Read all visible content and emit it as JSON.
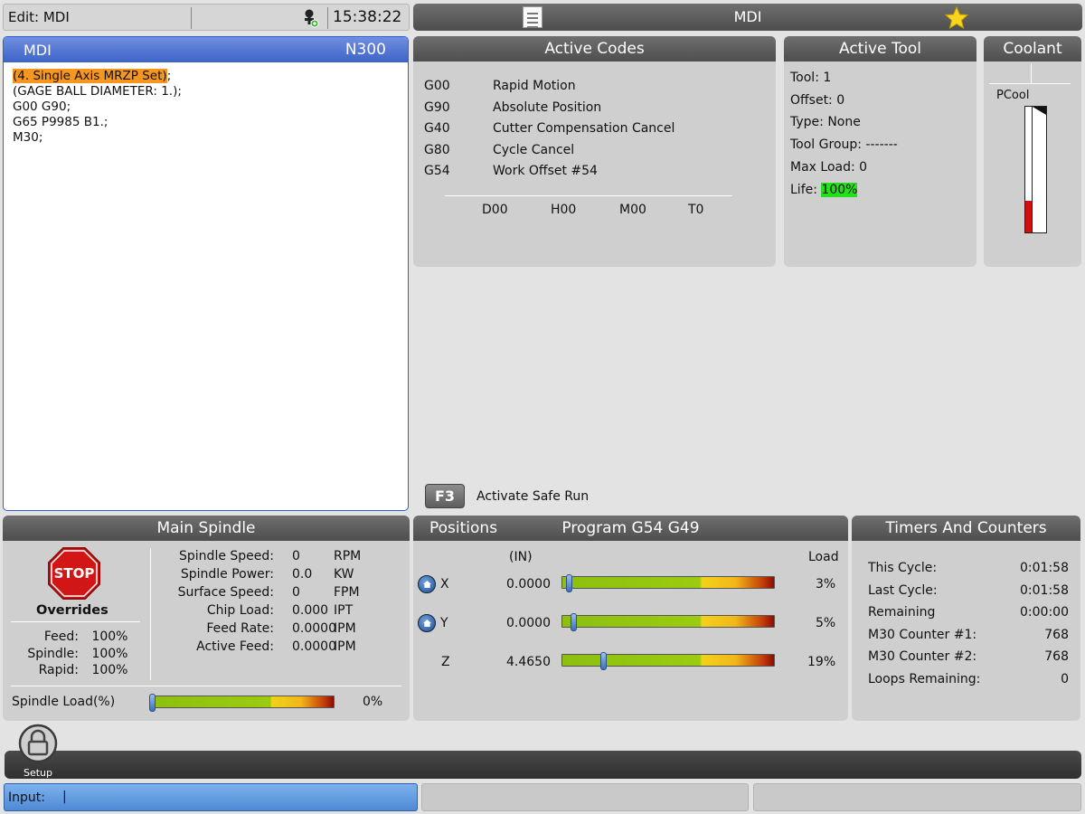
{
  "topbar": {
    "edit_label": "Edit: MDI",
    "clock": "15:38:22",
    "mode": "MDI"
  },
  "mdi": {
    "title": "MDI",
    "line": "N300",
    "lines": [
      {
        "text": "(4. Single Axis MRZP Set)",
        "suffix": ";"
      },
      {
        "text": "(GAGE BALL DIAMETER: 1.);",
        "suffix": ""
      },
      {
        "text": "G00 G90;",
        "suffix": ""
      },
      {
        "text": "G65 P9985 B1.;",
        "suffix": ""
      },
      {
        "text": "M30;",
        "suffix": ""
      }
    ]
  },
  "active_codes": {
    "title": "Active Codes",
    "rows": [
      {
        "code": "G00",
        "desc": "Rapid Motion"
      },
      {
        "code": "G90",
        "desc": "Absolute Position"
      },
      {
        "code": "G40",
        "desc": "Cutter Compensation Cancel"
      },
      {
        "code": "G80",
        "desc": "Cycle Cancel"
      },
      {
        "code": "G54",
        "desc": "Work Offset #54"
      }
    ],
    "dhmt": [
      "D00",
      "H00",
      "M00",
      "T0"
    ]
  },
  "active_tool": {
    "title": "Active Tool",
    "tool": "Tool: 1",
    "offset": "Offset: 0",
    "type": "Type: None",
    "group": "Tool Group: -------",
    "maxload": "Max Load: 0",
    "life_label": "Life:",
    "life_value": "100%"
  },
  "coolant": {
    "title": "Coolant",
    "label": "PCool",
    "level": 0.25
  },
  "safe_run": {
    "key": "F3",
    "label": "Activate Safe Run"
  },
  "spindle": {
    "title": "Main Spindle",
    "stop_label": "STOP",
    "overrides_title": "Overrides",
    "overrides": [
      {
        "label": "Feed:",
        "value": "100%"
      },
      {
        "label": "Spindle:",
        "value": "100%"
      },
      {
        "label": "Rapid:",
        "value": "100%"
      }
    ],
    "stats": [
      {
        "label": "Spindle Speed:",
        "value": "0",
        "unit": "RPM"
      },
      {
        "label": "Spindle Power:",
        "value": "0.0",
        "unit": "KW"
      },
      {
        "label": "Surface Speed:",
        "value": "0",
        "unit": "FPM"
      },
      {
        "label": "Chip Load:",
        "value": "0.000",
        "unit": "IPT"
      },
      {
        "label": "Feed Rate:",
        "value": "0.0000",
        "unit": "IPM"
      },
      {
        "label": "Active Feed:",
        "value": "0.0000",
        "unit": "IPM"
      }
    ],
    "load_label": "Spindle Load(%)",
    "load_value": "0%",
    "load": 0
  },
  "positions": {
    "title": "Positions",
    "program": "Program G54 G49",
    "units": "(IN)",
    "load_header": "Load",
    "axes": [
      {
        "axis": "X",
        "value": "0.0000",
        "load": "3%",
        "load_frac": 0.03,
        "home": true
      },
      {
        "axis": "Y",
        "value": "0.0000",
        "load": "5%",
        "load_frac": 0.05,
        "home": true
      },
      {
        "axis": "Z",
        "value": "4.4650",
        "load": "19%",
        "load_frac": 0.19,
        "home": false
      }
    ]
  },
  "timers": {
    "title": "Timers And Counters",
    "rows": [
      {
        "label": "This Cycle:",
        "value": "0:01:58"
      },
      {
        "label": "Last Cycle:",
        "value": "0:01:58"
      },
      {
        "label": "Remaining",
        "value": "0:00:00"
      },
      {
        "label": "M30 Counter #1:",
        "value": "768"
      },
      {
        "label": "M30 Counter #2:",
        "value": "768"
      },
      {
        "label": "Loops Remaining:",
        "value": "0"
      }
    ]
  },
  "setup": {
    "label": "Setup"
  },
  "input": {
    "label": "Input:",
    "value": "|"
  }
}
